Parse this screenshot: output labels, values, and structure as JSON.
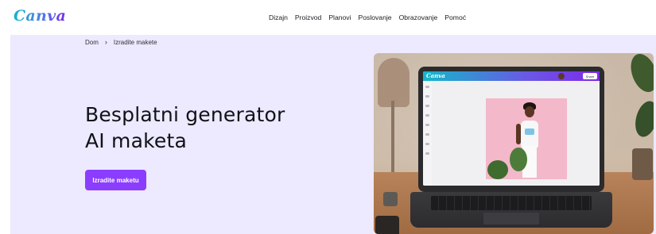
{
  "brand": {
    "logo_text": "Canva",
    "accent": "#8b3dff",
    "hero_bg": "#ede9fe"
  },
  "nav": {
    "items": [
      {
        "label": "Dizajn"
      },
      {
        "label": "Proizvod"
      },
      {
        "label": "Planovi"
      },
      {
        "label": "Poslovanje"
      },
      {
        "label": "Obrazovanje"
      },
      {
        "label": "Pomoć"
      }
    ]
  },
  "breadcrumb": {
    "home": "Dom",
    "separator": "›",
    "current": "Izradite makete"
  },
  "hero": {
    "headline_line1": "Besplatni generator",
    "headline_line2": "AI maketa",
    "cta_label": "Izradite maketu"
  },
  "mockup_app": {
    "logo_text": "Canva",
    "share_label": "Share"
  },
  "icons": [
    "chevron-right-icon"
  ]
}
